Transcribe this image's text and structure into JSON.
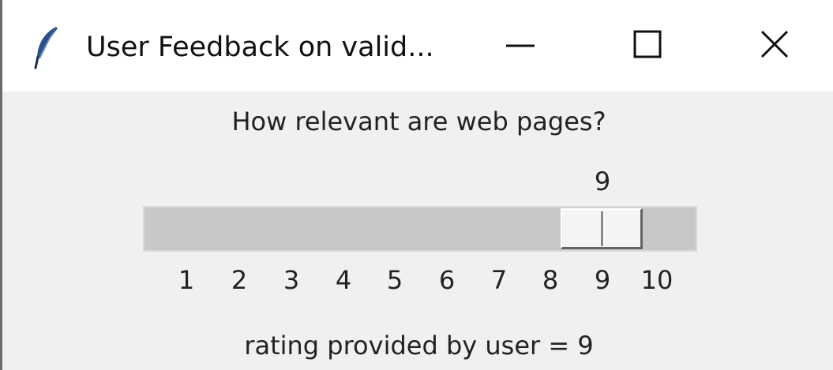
{
  "window": {
    "title": "User Feedback on valid...",
    "controls": {
      "minimize": "minimize-icon",
      "maximize": "maximize-icon",
      "close": "close-icon"
    },
    "app_icon": "feather-icon"
  },
  "question": "How relevant are web pages?",
  "slider": {
    "value": 9,
    "value_label": "9",
    "min": 1,
    "max": 10,
    "tick_labels": [
      "1",
      "2",
      "3",
      "4",
      "5",
      "6",
      "7",
      "8",
      "9",
      "10"
    ]
  },
  "result_text": "rating provided by user = 9",
  "colors": {
    "trough": "#c8c8c8",
    "background": "#f0f0f0",
    "titlebar": "#ffffff"
  }
}
